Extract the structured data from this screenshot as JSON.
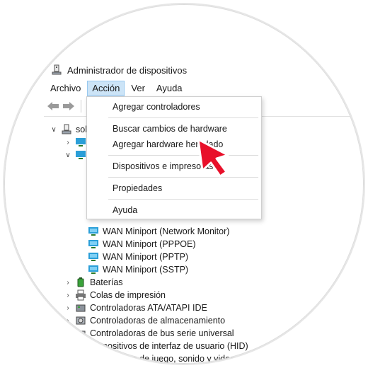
{
  "window": {
    "title": "Administrador de dispositivos"
  },
  "menubar": {
    "items": [
      {
        "label": "Archivo"
      },
      {
        "label": "Acción"
      },
      {
        "label": "Ver"
      },
      {
        "label": "Ayuda"
      }
    ]
  },
  "dropdown": {
    "items": [
      {
        "label": "Agregar controladores"
      },
      {
        "label": "Buscar cambios de hardware"
      },
      {
        "label": "Agregar hardware heredado"
      },
      {
        "label": "Dispositivos e impresoras"
      },
      {
        "label": "Propiedades"
      },
      {
        "label": "Ayuda"
      }
    ]
  },
  "tree": {
    "root_label": "sol",
    "wan_items": [
      {
        "label": "WAN Miniport (Network Monitor)"
      },
      {
        "label": "WAN Miniport (PPPOE)"
      },
      {
        "label": "WAN Miniport (PPTP)"
      },
      {
        "label": "WAN Miniport (SSTP)"
      }
    ],
    "categories": [
      {
        "label": "Baterías",
        "icon": "battery-icon"
      },
      {
        "label": "Colas de impresión",
        "icon": "printer-icon"
      },
      {
        "label": "Controladoras ATA/ATAPI IDE",
        "icon": "disk-controller-icon"
      },
      {
        "label": "Controladoras de almacenamiento",
        "icon": "storage-controller-icon"
      },
      {
        "label": "Controladoras de bus serie universal",
        "icon": "usb-icon"
      },
      {
        "label": "Dispositivos de interfaz de usuario (HID)",
        "icon": "hid-icon"
      },
      {
        "label": "Dispositivos de juego, sonido y video",
        "icon": "sound-icon"
      }
    ]
  },
  "colors": {
    "menu_active_bg": "#cce4f7",
    "menu_active_border": "#99c9ef",
    "cursor_red": "#e8102a"
  }
}
